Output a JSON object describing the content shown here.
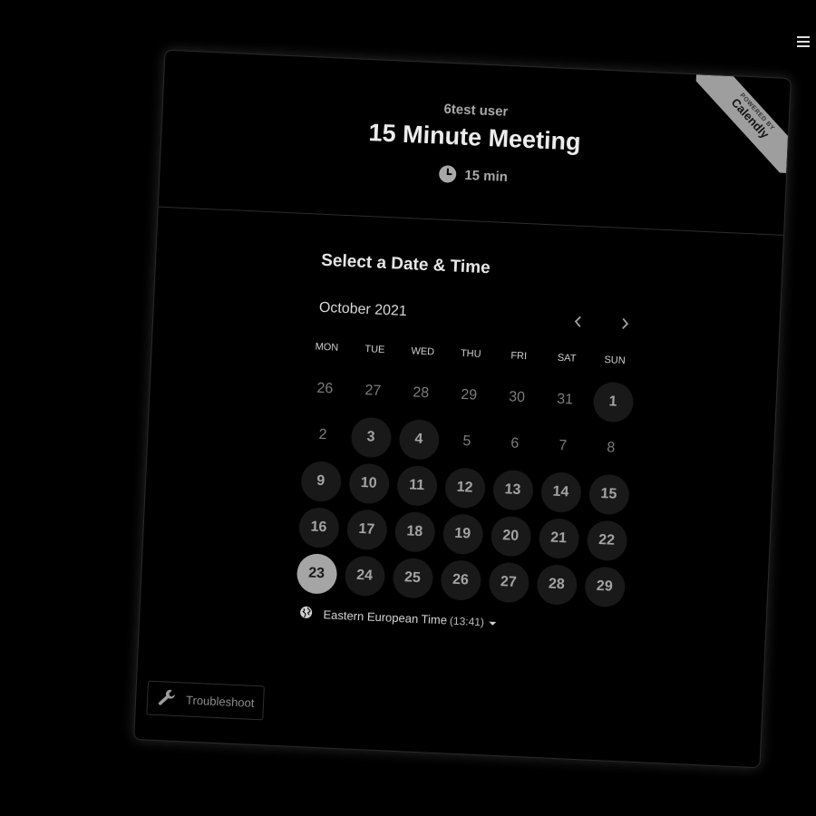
{
  "header": {
    "user_name": "6test user",
    "meeting_title": "15 Minute Meeting",
    "duration": "15 min"
  },
  "ribbon": {
    "powered_by": "POWERED BY",
    "brand": "Calendly"
  },
  "calendar": {
    "section_title": "Select a Date & Time",
    "month": "October 2021",
    "weekdays": [
      "MON",
      "TUE",
      "WED",
      "THU",
      "FRI",
      "SAT",
      "SUN"
    ],
    "weeks": [
      [
        {
          "label": "26",
          "state": "disabled"
        },
        {
          "label": "27",
          "state": "disabled"
        },
        {
          "label": "28",
          "state": "disabled"
        },
        {
          "label": "29",
          "state": "disabled"
        },
        {
          "label": "30",
          "state": "disabled"
        },
        {
          "label": "31",
          "state": "disabled"
        },
        {
          "label": "1",
          "state": "available"
        }
      ],
      [
        {
          "label": "2",
          "state": "disabled"
        },
        {
          "label": "3",
          "state": "available"
        },
        {
          "label": "4",
          "state": "available"
        },
        {
          "label": "5",
          "state": "disabled"
        },
        {
          "label": "6",
          "state": "disabled"
        },
        {
          "label": "7",
          "state": "disabled"
        },
        {
          "label": "8",
          "state": "disabled"
        }
      ],
      [
        {
          "label": "9",
          "state": "available"
        },
        {
          "label": "10",
          "state": "available"
        },
        {
          "label": "11",
          "state": "available"
        },
        {
          "label": "12",
          "state": "available"
        },
        {
          "label": "13",
          "state": "available"
        },
        {
          "label": "14",
          "state": "available"
        },
        {
          "label": "15",
          "state": "available"
        }
      ],
      [
        {
          "label": "16",
          "state": "available"
        },
        {
          "label": "17",
          "state": "available"
        },
        {
          "label": "18",
          "state": "available"
        },
        {
          "label": "19",
          "state": "available"
        },
        {
          "label": "20",
          "state": "available"
        },
        {
          "label": "21",
          "state": "available"
        },
        {
          "label": "22",
          "state": "available"
        }
      ],
      [
        {
          "label": "23",
          "state": "selected"
        },
        {
          "label": "24",
          "state": "available"
        },
        {
          "label": "25",
          "state": "available"
        },
        {
          "label": "26",
          "state": "available"
        },
        {
          "label": "27",
          "state": "available"
        },
        {
          "label": "28",
          "state": "available"
        },
        {
          "label": "29",
          "state": "available"
        }
      ]
    ]
  },
  "timezone": {
    "name": "Eastern European Time",
    "time": "(13:41)"
  },
  "troubleshoot": {
    "label": "Troubleshoot"
  },
  "icons": {
    "menu": "hamburger-menu-icon",
    "clock": "clock-icon",
    "globe": "globe-icon",
    "wrench": "wrench-icon",
    "prev": "chevron-left-icon",
    "next": "chevron-right-icon"
  },
  "colors": {
    "background": "#000000",
    "available_day_bg": "#191919",
    "selected_day_bg": "#a5a5a5",
    "ribbon_bg": "#9e9e9e"
  }
}
